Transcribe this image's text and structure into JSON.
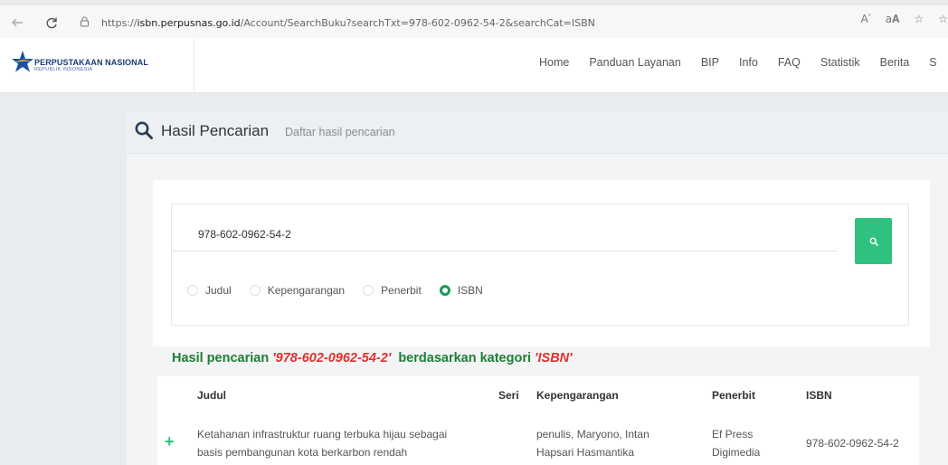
{
  "browser": {
    "url_prefix": "https://",
    "url_host": "isbn.perpusnas.go.id",
    "url_path": "/Account/SearchBuku?searchTxt=978-602-0962-54-2&searchCat=ISBN",
    "icons": [
      "back-arrow-icon",
      "reload-icon",
      "lock-icon",
      "read-aloud-icon",
      "translate-icon",
      "favorite-icon",
      "collections-icon"
    ]
  },
  "header": {
    "brand_name": "PERPUSTAKAAN NASIONAL",
    "brand_sub": "REPUBLIK INDONESIA",
    "nav": [
      "Home",
      "Panduan Layanan",
      "BIP",
      "Info",
      "FAQ",
      "Statistik",
      "Berita",
      "S"
    ]
  },
  "panel": {
    "title": "Hasil Pencarian",
    "subtitle": "Daftar hasil pencarian"
  },
  "search": {
    "value": "978-602-0962-54-2",
    "options": [
      {
        "label": "Judul",
        "selected": false
      },
      {
        "label": "Kepengarangan",
        "selected": false
      },
      {
        "label": "Penerbit",
        "selected": false
      },
      {
        "label": "ISBN",
        "selected": true
      }
    ]
  },
  "result": {
    "prefix": "Hasil pencarian",
    "query": "'978-602-0962-54-2'",
    "middle": "berdasarkan kategori",
    "category": "'ISBN'"
  },
  "table": {
    "headers": {
      "judul": "Judul",
      "seri": "Seri",
      "kepengarangan": "Kepengarangan",
      "penerbit": "Penerbit",
      "isbn": "ISBN"
    },
    "rows": [
      {
        "judul_1": "Ketahanan infrastruktur ruang terbuka hijau sebagai",
        "judul_2": "basis pembangunan kota berkarbon rendah",
        "seri": "",
        "kepengarangan_1": "penulis, Maryono, Intan",
        "kepengarangan_2": "Hapsari Hasmantika",
        "penerbit_1": "Ef Press",
        "penerbit_2": "Digimedia",
        "isbn": "978-602-0962-54-2"
      }
    ]
  },
  "colors": {
    "accent_green": "#2ec27e",
    "result_green": "#1e7e34",
    "query_red": "#e0312f"
  }
}
